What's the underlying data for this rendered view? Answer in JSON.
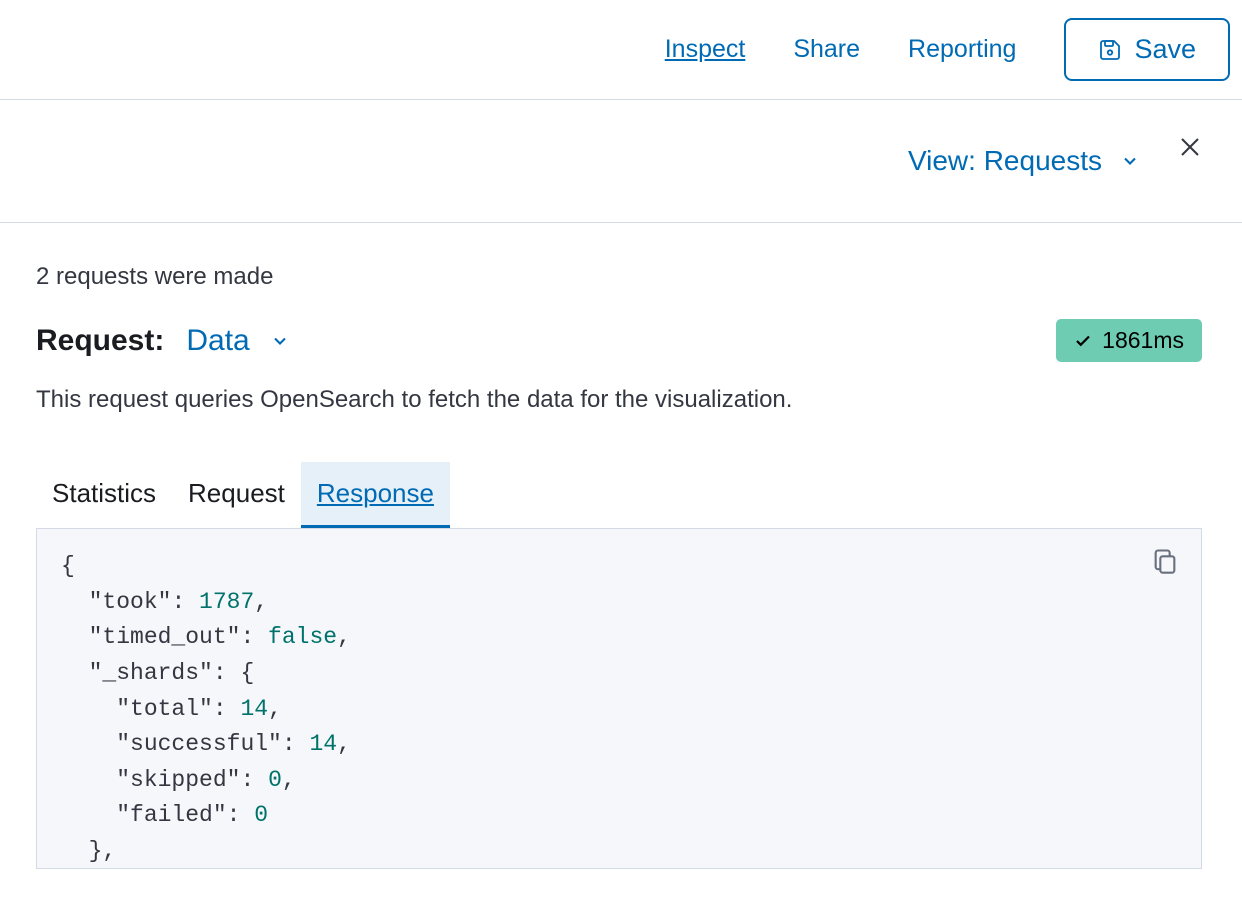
{
  "toolbar": {
    "inspect": "Inspect",
    "share": "Share",
    "reporting": "Reporting",
    "save": "Save"
  },
  "view": {
    "label_prefix": "View: ",
    "value": "Requests"
  },
  "requests_count_text": "2 requests were made",
  "request": {
    "label": "Request:",
    "dropdown_value": "Data",
    "time_badge": "1861ms",
    "description": "This request queries OpenSearch to fetch the data for the visualization."
  },
  "tabs": {
    "statistics": "Statistics",
    "request": "Request",
    "response": "Response"
  },
  "response_json": {
    "took": 1787,
    "timed_out": false,
    "_shards": {
      "total": 14,
      "successful": 14,
      "skipped": 0,
      "failed": 0
    }
  }
}
